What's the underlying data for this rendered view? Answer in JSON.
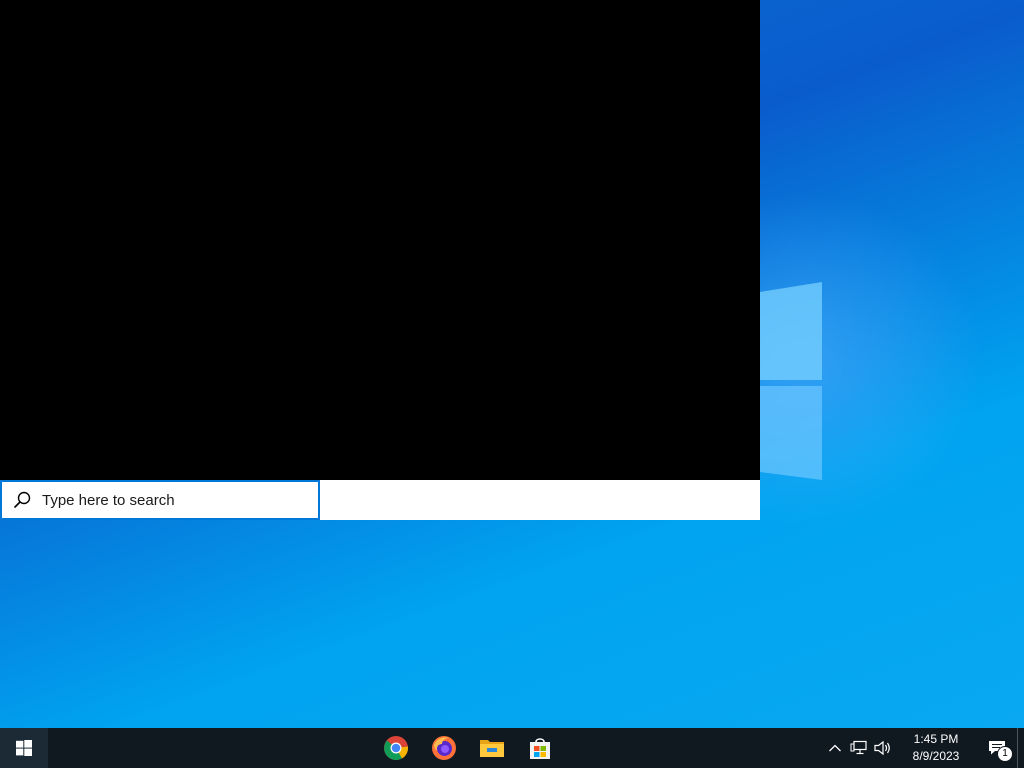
{
  "search": {
    "placeholder": "Type here to search"
  },
  "taskbar": {
    "pinned": [
      {
        "app": "Google Chrome",
        "icon": "chrome-icon"
      },
      {
        "app": "Firefox",
        "icon": "firefox-icon"
      },
      {
        "app": "File Explorer",
        "icon": "file-explorer-icon"
      },
      {
        "app": "Microsoft Store",
        "icon": "microsoft-store-icon"
      }
    ],
    "tray": {
      "time": "1:45 PM",
      "date": "8/9/2023",
      "notification_count": "1"
    }
  },
  "colors": {
    "accent": "#0078d7",
    "taskbar": "#101820",
    "search_panel": "#000000"
  }
}
